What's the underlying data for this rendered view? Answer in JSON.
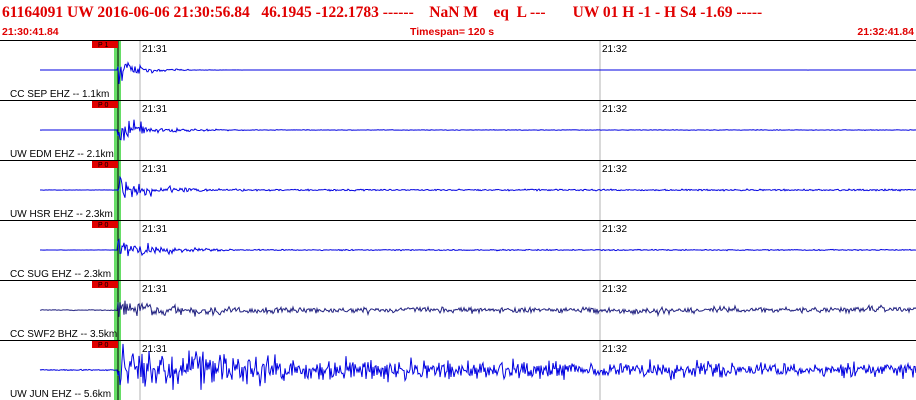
{
  "header": {
    "event_id": "61164091",
    "network": "UW",
    "datetime": "2016-06-06 21:30:56.84",
    "lat": "46.1945",
    "lon": "-122.1783",
    "dashes": "------",
    "magnitude": "NaN M",
    "etype": "eq",
    "class": "L ---",
    "tail": "UW 01  H  -1  -  H S4   -1.69 -----"
  },
  "subheader": {
    "start_time": "21:30:41.84",
    "timespan": "Timespan= 120 s",
    "end_time": "21:32:41.84"
  },
  "time_marks": [
    "21:31",
    "21:32"
  ],
  "colors": {
    "header_text": "#e00000",
    "trace": "#0000e0",
    "trace_broadband": "#202080",
    "pick_box": "#e00000",
    "pick_band": "#66dd66",
    "grid": "#808080"
  },
  "traces": [
    {
      "label": "CC SEP EHZ -- 1.1km",
      "pick": "P 1",
      "amp": 1.0,
      "decay": 0.045,
      "noise": 0.01,
      "tail": 0.0,
      "broadband": false
    },
    {
      "label": "UW EDM EHZ -- 2.1km",
      "pick": "P 0",
      "amp": 1.15,
      "decay": 0.035,
      "noise": 0.015,
      "tail": 0.02,
      "broadband": false
    },
    {
      "label": "UW HSR EHZ -- 2.3km",
      "pick": "P 0",
      "amp": 0.85,
      "decay": 0.03,
      "noise": 0.05,
      "tail": 0.06,
      "broadband": false
    },
    {
      "label": "CC SUG EHZ -- 2.3km",
      "pick": "P 0",
      "amp": 0.9,
      "decay": 0.03,
      "noise": 0.04,
      "tail": 0.04,
      "broadband": false
    },
    {
      "label": "CC SWF2 BHZ -- 3.5km",
      "pick": "P 0",
      "amp": 0.6,
      "decay": 0.02,
      "noise": 0.12,
      "tail": 0.22,
      "broadband": true
    },
    {
      "label": "UW JUN EHZ -- 5.6km",
      "pick": "P 0",
      "amp": 1.25,
      "decay": 0.006,
      "noise": 0.18,
      "tail": 0.55,
      "broadband": false
    }
  ]
}
